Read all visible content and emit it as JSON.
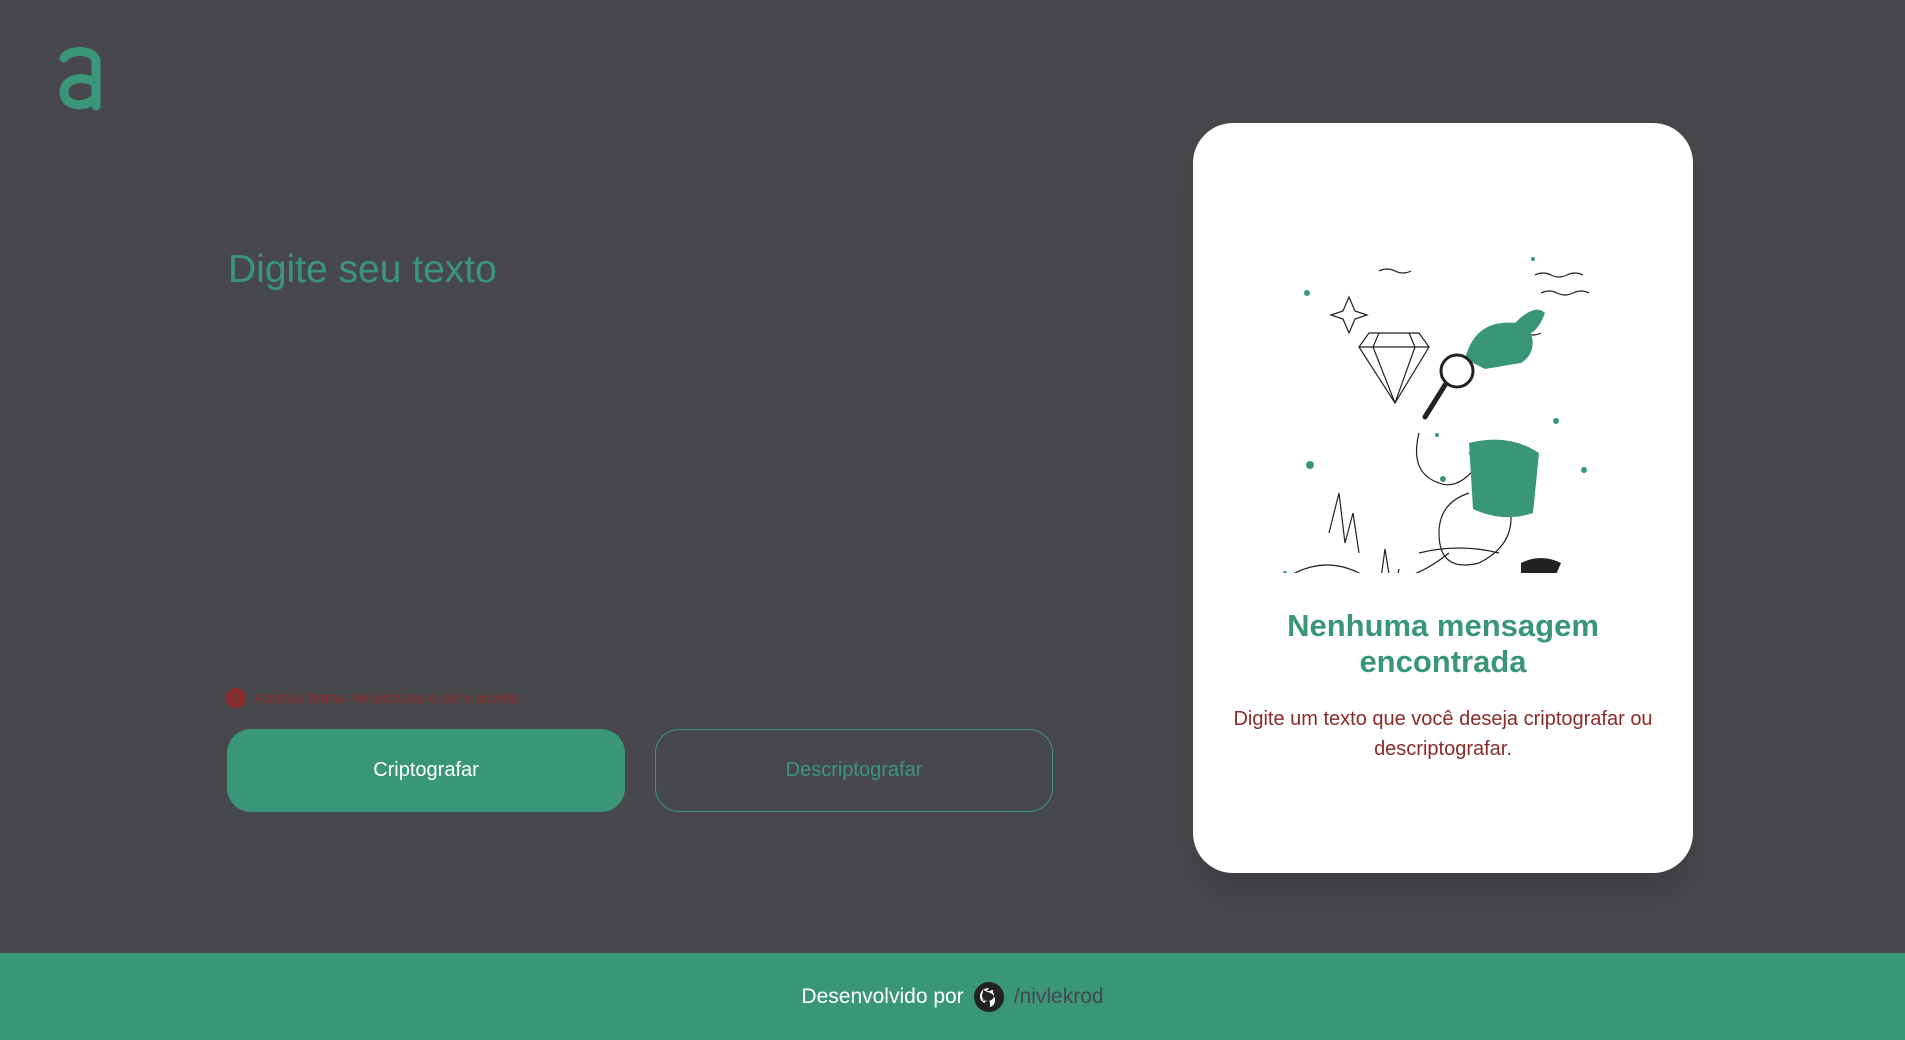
{
  "logo": {
    "letter": "a",
    "color": "#3a9679"
  },
  "input": {
    "placeholder": "Digite seu texto",
    "value": ""
  },
  "hint": {
    "icon": "alert-circle-icon",
    "text": "Apenas letras minúsculas e sem acento"
  },
  "buttons": {
    "encrypt_label": "Criptografar",
    "decrypt_label": "Descriptografar"
  },
  "output": {
    "illustration": "person-with-magnifying-glass-illustration",
    "title": "Nenhuma mensagem encontrada",
    "text": "Digite um texto que você deseja criptografar ou descriptografar."
  },
  "footer": {
    "text": "Desenvolvido por",
    "icon": "github-icon",
    "link": "/nivlekrod"
  },
  "colors": {
    "background": "#47484c",
    "accent": "#3a9679",
    "error": "#8b2a2a",
    "card": "#ffffff"
  }
}
